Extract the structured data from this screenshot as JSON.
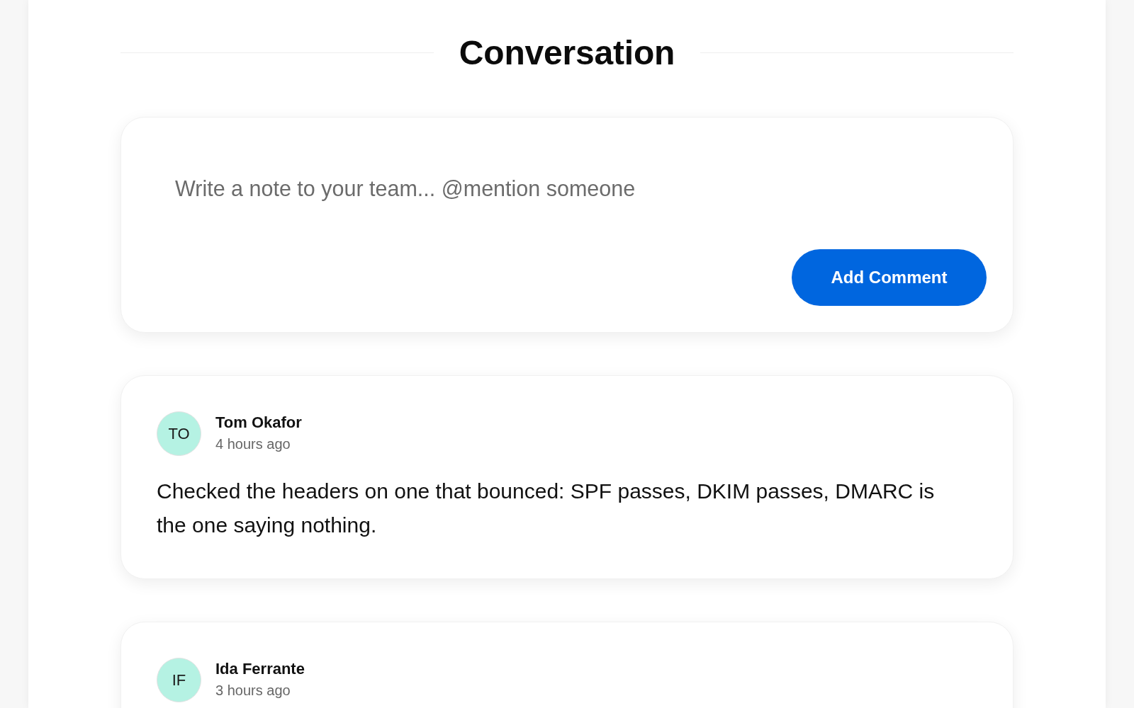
{
  "title": "Conversation",
  "composer": {
    "placeholder": "Write a note to your team... @mention someone",
    "button": "Add Comment"
  },
  "comments": [
    {
      "initials": "TO",
      "author": "Tom Okafor",
      "time": "4 hours ago",
      "body": "Checked the headers on one that bounced: SPF passes, DKIM passes, DMARC is the one saying nothing."
    },
    {
      "initials": "IF",
      "author": "Ida Ferrante",
      "time": "3 hours ago"
    }
  ]
}
